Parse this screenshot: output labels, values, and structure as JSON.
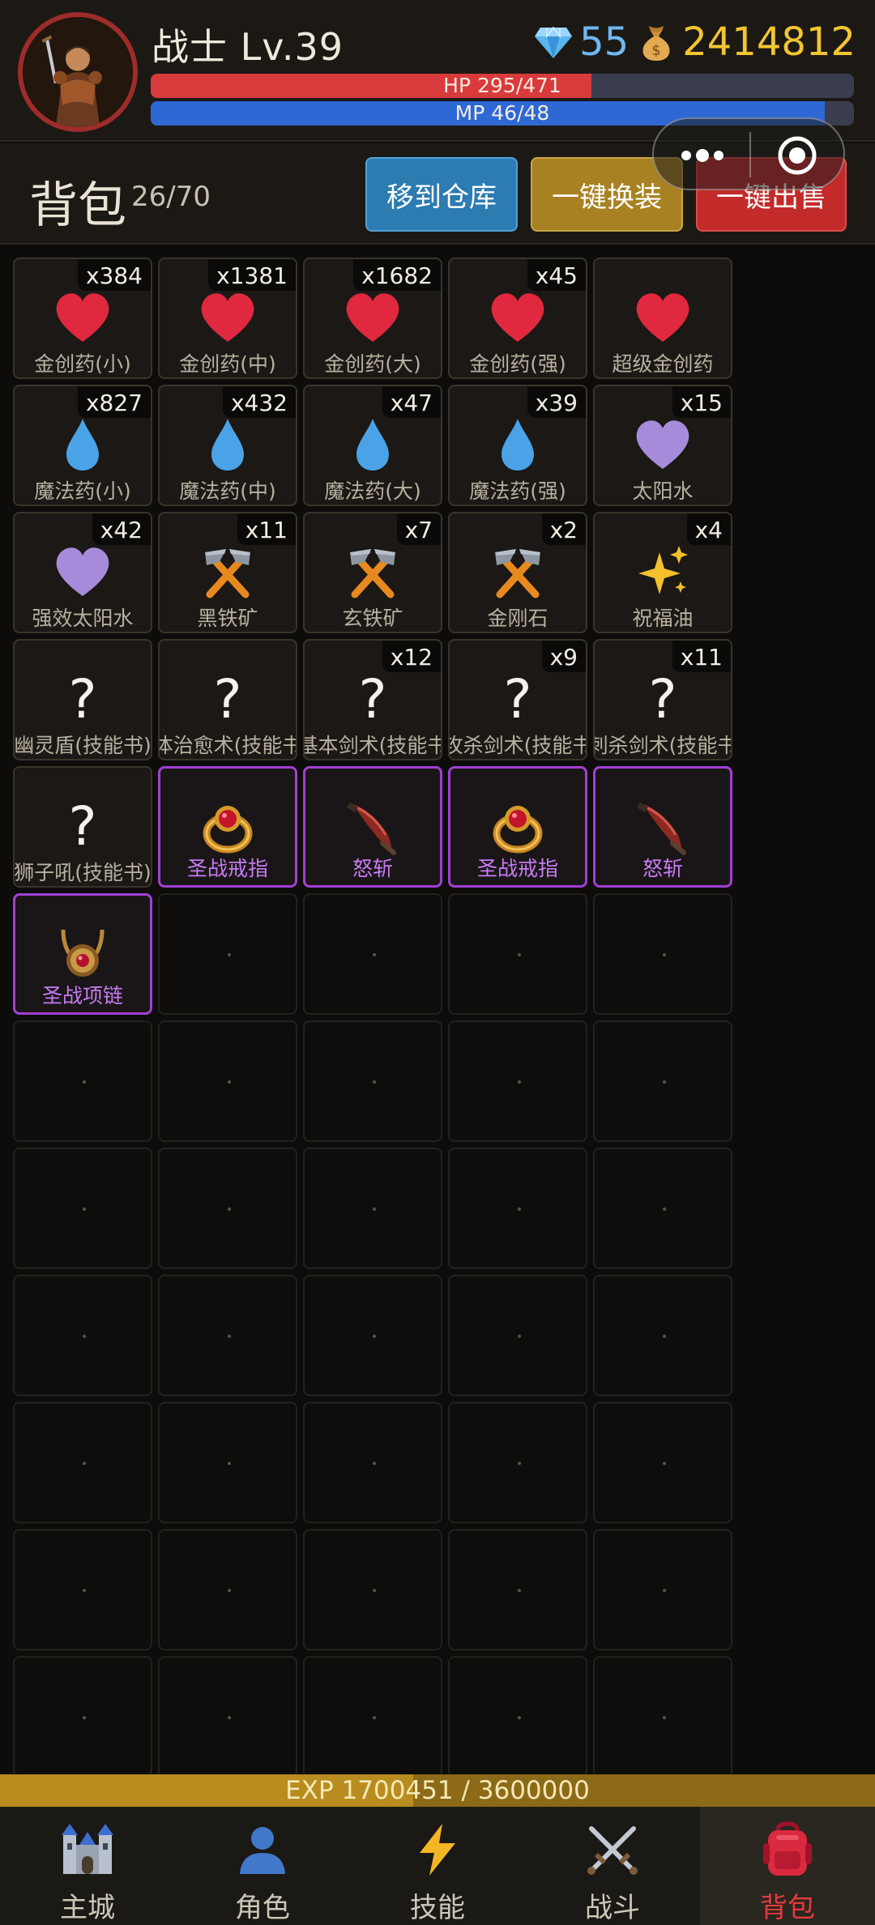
{
  "player": {
    "name_level": "战士 Lv.39",
    "gems": "55",
    "gold": "2414812",
    "hp_text": "HP 295/471",
    "hp_ratio": 0.6263,
    "mp_text": "MP 46/48",
    "mp_ratio": 0.9583
  },
  "bag": {
    "title": "背包",
    "count": "26/70",
    "buttons": {
      "to_storage": "移到仓库",
      "auto_equip": "一键换装",
      "quick_sell": "一键出售"
    }
  },
  "slots": [
    {
      "name": "金创药(小)",
      "qty": "x384",
      "icon": "heart-icon",
      "color": "#e0283f",
      "kind": "heart"
    },
    {
      "name": "金创药(中)",
      "qty": "x1381",
      "icon": "heart-icon",
      "color": "#e0283f",
      "kind": "heart"
    },
    {
      "name": "金创药(大)",
      "qty": "x1682",
      "icon": "heart-icon",
      "color": "#e0283f",
      "kind": "heart"
    },
    {
      "name": "金创药(强)",
      "qty": "x45",
      "icon": "heart-icon",
      "color": "#e0283f",
      "kind": "heart"
    },
    {
      "name": "超级金创药",
      "qty": "",
      "icon": "heart-icon",
      "color": "#e0283f",
      "kind": "heart"
    },
    {
      "name": "魔法药(小)",
      "qty": "x827",
      "icon": "droplet-icon",
      "color": "#4aa3e6",
      "kind": "drop"
    },
    {
      "name": "魔法药(中)",
      "qty": "x432",
      "icon": "droplet-icon",
      "color": "#4aa3e6",
      "kind": "drop"
    },
    {
      "name": "魔法药(大)",
      "qty": "x47",
      "icon": "droplet-icon",
      "color": "#4aa3e6",
      "kind": "drop"
    },
    {
      "name": "魔法药(强)",
      "qty": "x39",
      "icon": "droplet-icon",
      "color": "#4aa3e6",
      "kind": "drop"
    },
    {
      "name": "太阳水",
      "qty": "x15",
      "icon": "purple-heart-icon",
      "color": "#a78bdb",
      "kind": "heart"
    },
    {
      "name": "强效太阳水",
      "qty": "x42",
      "icon": "purple-heart-icon",
      "color": "#a78bdb",
      "kind": "heart"
    },
    {
      "name": "黑铁矿",
      "qty": "x11",
      "icon": "crossed-hammers-icon",
      "color": "#e8891f",
      "kind": "hammer"
    },
    {
      "name": "玄铁矿",
      "qty": "x7",
      "icon": "crossed-hammers-icon",
      "color": "#e8891f",
      "kind": "hammer"
    },
    {
      "name": "金刚石",
      "qty": "x2",
      "icon": "crossed-hammers-icon",
      "color": "#e8891f",
      "kind": "hammer"
    },
    {
      "name": "祝福油",
      "qty": "x4",
      "icon": "sparkles-icon",
      "color": "#f5c02c",
      "kind": "sparkle"
    },
    {
      "name": "幽灵盾(技能书)",
      "qty": "",
      "icon": "question-icon",
      "glyph": "?",
      "kind": "question"
    },
    {
      "name": "体治愈术(技能书",
      "qty": "",
      "icon": "question-icon",
      "glyph": "?",
      "kind": "question"
    },
    {
      "name": "基本剑术(技能书",
      "qty": "x12",
      "icon": "question-icon",
      "glyph": "?",
      "kind": "question"
    },
    {
      "name": "攻杀剑术(技能书",
      "qty": "x9",
      "icon": "question-icon",
      "glyph": "?",
      "kind": "question"
    },
    {
      "name": "刺杀剑术(技能书",
      "qty": "x11",
      "icon": "question-icon",
      "glyph": "?",
      "kind": "question"
    },
    {
      "name": "狮子吼(技能书)",
      "qty": "",
      "icon": "question-icon",
      "glyph": "?",
      "kind": "question"
    },
    {
      "name": "圣战戒指",
      "qty": "",
      "icon": "ring-icon",
      "kind": "ring",
      "equip": true
    },
    {
      "name": "怒斩",
      "qty": "",
      "icon": "blade-icon",
      "kind": "blade",
      "equip": true
    },
    {
      "name": "圣战戒指",
      "qty": "",
      "icon": "ring-icon",
      "kind": "ring",
      "equip": true
    },
    {
      "name": "怒斩",
      "qty": "",
      "icon": "blade-icon",
      "kind": "blade",
      "equip": true
    },
    {
      "name": "圣战项链",
      "qty": "",
      "icon": "necklace-icon",
      "kind": "necklace",
      "equip": true
    }
  ],
  "visible_slot_count": 60,
  "exp": {
    "text": "EXP  1700451 / 3600000",
    "ratio": 0.4723
  },
  "nav": [
    {
      "label": "主城",
      "icon": "castle-icon"
    },
    {
      "label": "角色",
      "icon": "person-icon"
    },
    {
      "label": "技能",
      "icon": "lightning-icon"
    },
    {
      "label": "战斗",
      "icon": "crossed-swords-icon"
    },
    {
      "label": "背包",
      "icon": "backpack-icon",
      "active": true
    }
  ],
  "colors": {
    "accent_equip": "#a23fd4",
    "gold": "#f4c531",
    "gem": "#6fb8f2"
  }
}
